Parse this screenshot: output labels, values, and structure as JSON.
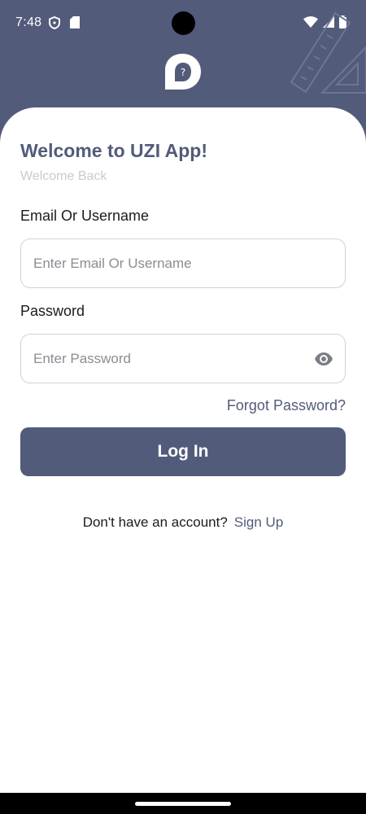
{
  "status_bar": {
    "time": "7:48",
    "icons": [
      "shield-icon",
      "sd-card-icon",
      "wifi-icon",
      "signal-icon",
      "battery-icon"
    ]
  },
  "header": {
    "logo_icon": "app-logo-icon",
    "decoration_icon": "rulers-icon"
  },
  "login": {
    "title": "Welcome to UZI App!",
    "subtitle": "Welcome Back",
    "email_label": "Email Or Username",
    "email_placeholder": "Enter Email Or Username",
    "email_value": "",
    "password_label": "Password",
    "password_placeholder": "Enter Password",
    "password_value": "",
    "forgot_password": "Forgot Password?",
    "login_button": "Log In",
    "signup_prompt": "Don't have an account?",
    "signup_link": "Sign Up"
  },
  "colors": {
    "primary": "#525b7a",
    "subtitle": "#c8cbd2",
    "input_border": "#cfd2d8"
  }
}
